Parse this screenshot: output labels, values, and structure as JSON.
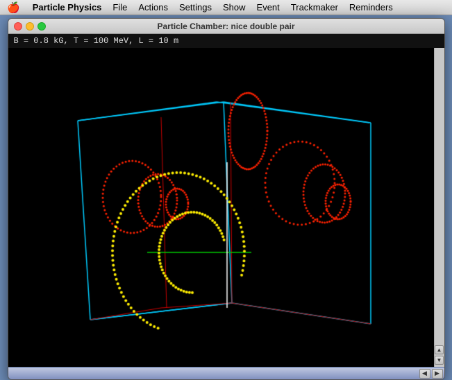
{
  "menubar": {
    "apple": "🍎",
    "items": [
      "Particle Physics",
      "File",
      "Actions",
      "Settings",
      "Show",
      "Event",
      "Trackmaker",
      "Reminders"
    ]
  },
  "window": {
    "title": "Particle Chamber: nice double pair",
    "info": "B = 0.8 kG, T = 100 MeV, L = 10 m"
  },
  "scrollbar": {
    "up_arrow": "▲",
    "down_arrow": "▼"
  },
  "bottom_nav": {
    "left_arrow": "◀",
    "right_arrow": "▶"
  },
  "colors": {
    "cyan_box": "#00ccff",
    "red_dots": "#ff2200",
    "yellow_dots": "#ffee00",
    "green_line": "#00cc00",
    "white_line": "#ffffff",
    "red_lines": "#cc0000"
  }
}
